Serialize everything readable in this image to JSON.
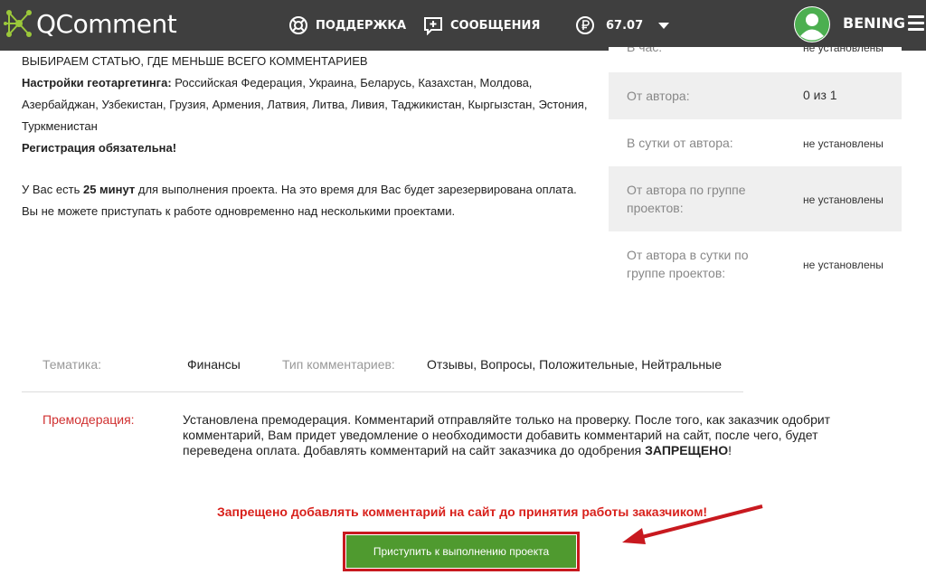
{
  "header": {
    "logo_text": "QComment",
    "support_label": "ПОДДЕРЖКА",
    "messages_label": "СООБЩЕНИЯ",
    "balance": "67.07",
    "user_name": "BENING"
  },
  "task": {
    "heading": "ВЫБИРАЕМ СТАТЬЮ, ГДЕ МЕНЬШЕ ВСЕГО КОММЕНТАРИЕВ",
    "geo_label": "Настройки геотаргетинга:",
    "geo_value": "Российская Федерация, Украина, Беларусь, Казахстан, Молдова, Азербайджан, Узбекистан, Грузия, Армения, Латвия, Литва, Ливия, Таджикистан, Кыргызстан, Эстония, Туркменистан",
    "registration": "Регистрация обязательна!",
    "time_prefix": "У Вас есть",
    "time_value": "25 минут",
    "time_suffix": "для выполнения проекта. На это время для Вас будет зарезервирована оплата.",
    "time_note": "Вы не можете приступать к работе одновременно над несколькими проектами."
  },
  "limits": [
    {
      "label": "В час:",
      "value": "не установлены"
    },
    {
      "label": "От автора:",
      "value": "0 из 1"
    },
    {
      "label": "В сутки от автора:",
      "value": "не установлены"
    },
    {
      "label": "От автора по группе проектов:",
      "value": "не установлены"
    },
    {
      "label": "От автора в сутки по группе проектов:",
      "value": "не установлены"
    }
  ],
  "details": {
    "topic_label": "Тематика:",
    "topic_value": "Финансы",
    "type_label": "Тип комментариев:",
    "type_value": "Отзывы, Вопросы, Положительные, Нейтральные",
    "premod_label": "Премодерация:",
    "premod_text": "Установлена премодерация. Комментарий отправляйте только на проверку. После того, как заказчик одобрит комментарий, Вам придет уведомление о необходимости добавить комментарий на сайт, после чего, будет переведена оплата. Добавлять комментарий на сайт заказчика до одобрения",
    "premod_strong": "ЗАПРЕЩЕНО",
    "premod_end": "!"
  },
  "warning": "Запрещено добавлять комментарий на сайт до принятия работы заказчиком!",
  "start_button": "Приступить к выполнению проекта",
  "colors": {
    "header_bg": "#3f3f3f",
    "accent_green": "#4f9a2f",
    "warning_red": "#d8201b"
  }
}
